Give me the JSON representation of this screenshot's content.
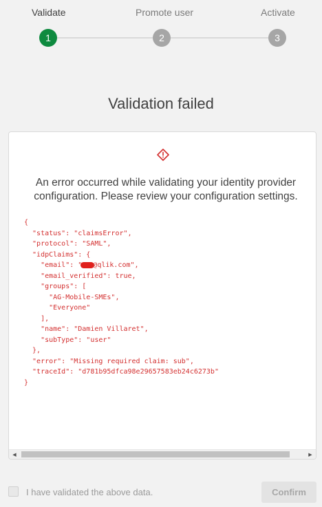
{
  "stepper": {
    "steps": [
      {
        "number": "1",
        "label": "Validate",
        "state": "active"
      },
      {
        "number": "2",
        "label": "Promote user",
        "state": "pending"
      },
      {
        "number": "3",
        "label": "Activate",
        "state": "pending"
      }
    ],
    "active_color": "#0e8a3f",
    "pending_color": "#a6a6a6"
  },
  "title": "Validation failed",
  "card": {
    "icon": "warning-diamond-icon",
    "message": "An error occurred while validating your identity provider configuration. Please review your configuration settings.",
    "json_lines": {
      "l01": "{",
      "l02": "  \"status\": \"claimsError\",",
      "l03": "  \"protocol\": \"SAML\",",
      "l04": "  \"idpClaims\": {",
      "l05a": "    \"email\": \"",
      "l05b": "@qlik.com\",",
      "l06": "    \"email_verified\": true,",
      "l07": "    \"groups\": [",
      "l08": "      \"AG-Mobile-SMEs\",",
      "l09": "      \"Everyone\"",
      "l10": "    ],",
      "l11": "    \"name\": \"Damien Villaret\",",
      "l12": "    \"subType\": \"user\"",
      "l13": "  },",
      "l14": "  \"error\": \"Missing required claim: sub\",",
      "l15": "  \"traceId\": \"d781b95dfca98e29657583eb24c6273b\"",
      "l16": "}"
    },
    "error_color": "#d32f2f"
  },
  "footer": {
    "checkbox_label": "I have validated the above data.",
    "checkbox_checked": false,
    "confirm_label": "Confirm"
  }
}
